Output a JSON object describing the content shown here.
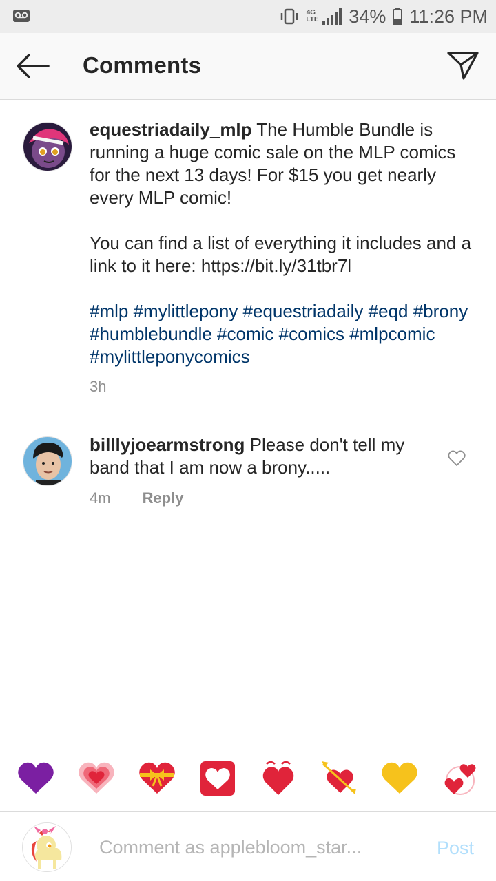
{
  "status_bar": {
    "icons": [
      "voicemail-icon",
      "vibrate-icon",
      "lte-icon",
      "signal-icon",
      "battery-icon"
    ],
    "network": "4G",
    "battery": "34%",
    "time": "11:26 PM"
  },
  "header": {
    "title": "Comments",
    "icons": [
      "back-arrow-icon",
      "direct-send-icon"
    ]
  },
  "caption": {
    "username": "equestriadaily_mlp",
    "text_first": " The Humble Bundle is running a huge comic sale on the MLP comics for the next 13 days! For $15 you get nearly every MLP comic!",
    "text_second": "You can find a list of everything it includes and a link to it here: https://bit.ly/31tbr7l",
    "hashtags": "#mlp #mylittlepony #equestriadaily #eqd #brony #humblebundle #comic #comics #mlpcomic #mylittleponycomics",
    "time": "3h"
  },
  "comments": [
    {
      "username": "billlyjoearmstrong",
      "text": " Please don't tell my band that I am now a brony.....",
      "time": "4m",
      "reply_label": "Reply"
    }
  ],
  "emoji_bar": {
    "emojis": [
      "purple-heart",
      "growing-heart",
      "heart-with-ribbon",
      "white-heart-on-red",
      "beating-heart",
      "heart-with-arrow",
      "yellow-heart",
      "revolving-hearts"
    ]
  },
  "composer": {
    "placeholder": "Comment as applebloom_star...",
    "post_label": "Post"
  },
  "colors": {
    "hashtag": "#003569",
    "secondary_text": "#8e8e8e",
    "post_button_disabled": "#b2dffc"
  }
}
